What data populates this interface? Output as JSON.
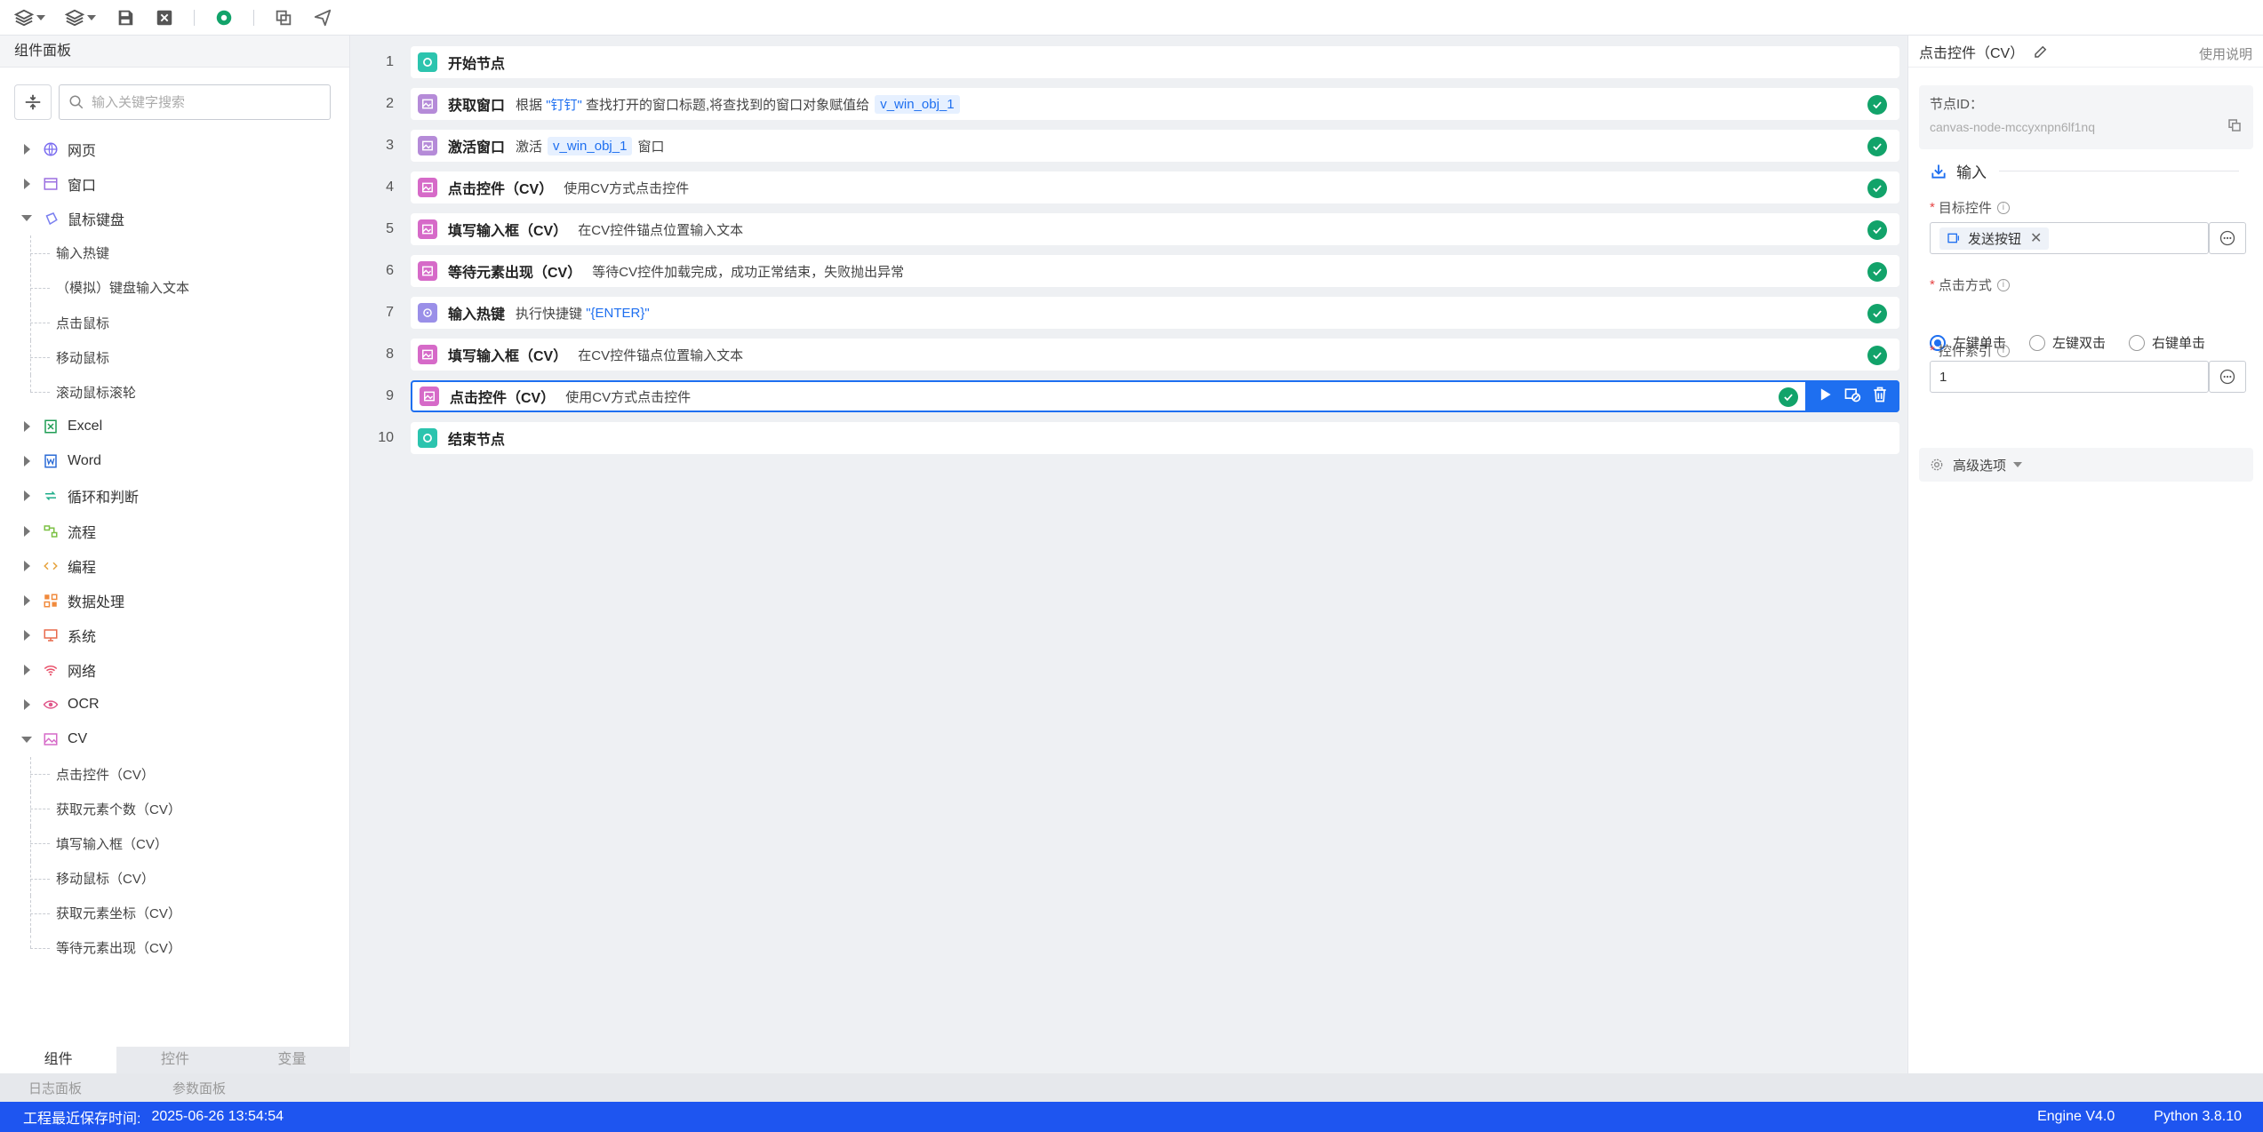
{
  "toolbar": {
    "icons": [
      "layers-dropdown-icon",
      "layers-alt-dropdown-icon",
      "save-icon",
      "close-icon",
      "run-icon",
      "copy-icon",
      "send-icon"
    ]
  },
  "left_panel": {
    "title": "组件面板",
    "search_placeholder": "输入关键字搜索",
    "categories": [
      {
        "label": "网页",
        "icon": "globe-icon",
        "color": "#7a6cf0",
        "expanded": false
      },
      {
        "label": "窗口",
        "icon": "window-icon",
        "color": "#9b6fe0",
        "expanded": false
      },
      {
        "label": "鼠标键盘",
        "icon": "mouse-keyboard-icon",
        "color": "#7a7ff0",
        "expanded": true,
        "children": [
          "输入热键",
          "（模拟）键盘输入文本",
          "点击鼠标",
          "移动鼠标",
          "滚动鼠标滚轮"
        ]
      },
      {
        "label": "Excel",
        "icon": "excel-icon",
        "color": "#1f9d55",
        "expanded": false
      },
      {
        "label": "Word",
        "icon": "word-icon",
        "color": "#2b6bd6",
        "expanded": false
      },
      {
        "label": "循环和判断",
        "icon": "loop-icon",
        "color": "#1fae8a",
        "expanded": false
      },
      {
        "label": "流程",
        "icon": "flow-icon",
        "color": "#7bc043",
        "expanded": false
      },
      {
        "label": "编程",
        "icon": "code-icon",
        "color": "#e6a23c",
        "expanded": false
      },
      {
        "label": "数据处理",
        "icon": "data-icon",
        "color": "#f08a3c",
        "expanded": false
      },
      {
        "label": "系统",
        "icon": "monitor-icon",
        "color": "#e86a4c",
        "expanded": false
      },
      {
        "label": "网络",
        "icon": "wifi-icon",
        "color": "#e8506a",
        "expanded": false
      },
      {
        "label": "OCR",
        "icon": "eye-icon",
        "color": "#e0568a",
        "expanded": false
      },
      {
        "label": "CV",
        "icon": "image-icon",
        "color": "#d66ac8",
        "expanded": true,
        "children": [
          "点击控件（CV）",
          "获取元素个数（CV）",
          "填写输入框（CV）",
          "移动鼠标（CV）",
          "获取元素坐标（CV）",
          "等待元素出现（CV）"
        ]
      }
    ],
    "bottom_tabs": [
      "组件",
      "控件",
      "变量"
    ]
  },
  "flow": [
    {
      "no": "1",
      "type": "start",
      "name": "开始节点",
      "parts": [],
      "ok": false
    },
    {
      "no": "2",
      "type": "win",
      "name": "获取窗口",
      "parts": [
        {
          "t": "text",
          "v": "根据 "
        },
        {
          "t": "hl",
          "v": "\"钉钉\""
        },
        {
          "t": "text",
          "v": " 查找打开的窗口标题,将查找到的窗口对象赋值给"
        },
        {
          "t": "var",
          "v": "v_win_obj_1"
        }
      ],
      "ok": true
    },
    {
      "no": "3",
      "type": "win",
      "name": "激活窗口",
      "parts": [
        {
          "t": "text",
          "v": "激活"
        },
        {
          "t": "var",
          "v": "v_win_obj_1"
        },
        {
          "t": "text",
          "v": "窗口"
        }
      ],
      "ok": true
    },
    {
      "no": "4",
      "type": "cv",
      "name": "点击控件（CV）",
      "parts": [
        {
          "t": "text",
          "v": "使用CV方式点击控件"
        }
      ],
      "ok": true
    },
    {
      "no": "5",
      "type": "cv",
      "name": "填写输入框（CV）",
      "parts": [
        {
          "t": "text",
          "v": "在CV控件锚点位置输入文本"
        }
      ],
      "ok": true
    },
    {
      "no": "6",
      "type": "cv",
      "name": "等待元素出现（CV）",
      "parts": [
        {
          "t": "text",
          "v": "等待CV控件加载完成，成功正常结束，失败抛出异常"
        }
      ],
      "ok": true
    },
    {
      "no": "7",
      "type": "hotkey",
      "name": "输入热键",
      "parts": [
        {
          "t": "text",
          "v": "执行快捷键 "
        },
        {
          "t": "hl",
          "v": "\"{ENTER}\""
        }
      ],
      "ok": true
    },
    {
      "no": "8",
      "type": "cv",
      "name": "填写输入框（CV）",
      "parts": [
        {
          "t": "text",
          "v": "在CV控件锚点位置输入文本"
        }
      ],
      "ok": true
    },
    {
      "no": "9",
      "type": "cv",
      "name": "点击控件（CV）",
      "parts": [
        {
          "t": "text",
          "v": "使用CV方式点击控件"
        }
      ],
      "ok": true,
      "selected": true
    },
    {
      "no": "10",
      "type": "start",
      "name": "结束节点",
      "parts": [],
      "ok": false
    }
  ],
  "right_panel": {
    "title": "点击控件（CV）",
    "help": "使用说明",
    "node_id_label": "节点ID：",
    "node_id_value": "canvas-node-mccyxnpn6lf1nq",
    "section_input": "输入",
    "target_label": "目标控件",
    "target_tag": "发送按钮",
    "click_mode_label": "点击方式",
    "click_modes": [
      "左键单击",
      "左键双击",
      "右键单击"
    ],
    "click_mode_selected": 0,
    "index_label": "控件索引",
    "index_value": "1",
    "advanced": "高级选项"
  },
  "log_tabs": [
    "日志面板",
    "参数面板"
  ],
  "status": {
    "saved_label": "工程最近保存时间:",
    "saved_time": "2025-06-26 13:54:54",
    "engine": "Engine V4.0",
    "python": "Python 3.8.10"
  },
  "colors": {
    "accent": "#1e6ff0",
    "status_bar": "#1e55f0",
    "success": "#12a36a",
    "start_node": "#2cc4ae",
    "cv_node": "#d66ac8"
  }
}
